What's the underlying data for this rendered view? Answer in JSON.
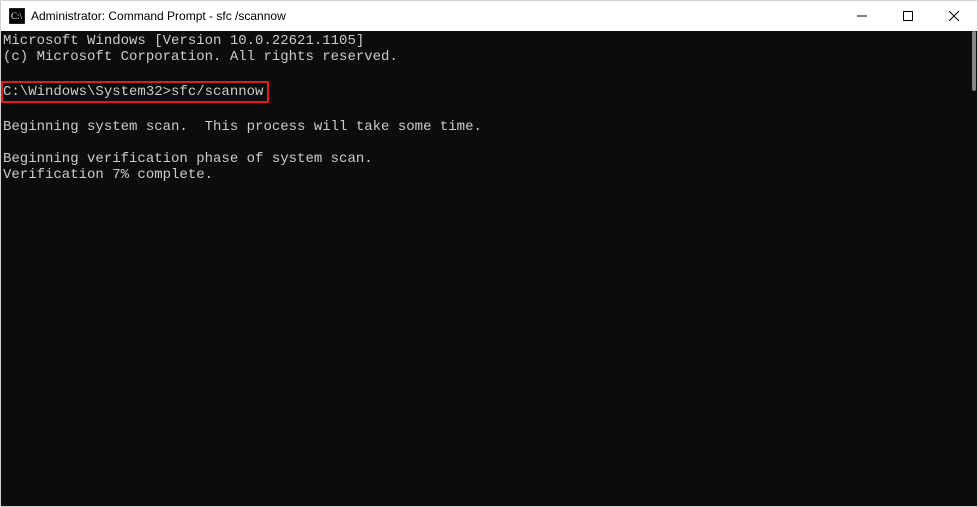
{
  "titlebar": {
    "title": "Administrator: Command Prompt - sfc /scannow"
  },
  "terminal": {
    "line1": "Microsoft Windows [Version 10.0.22621.1105]",
    "line2": "(c) Microsoft Corporation. All rights reserved.",
    "prompt_line": "C:\\Windows\\System32>sfc/scannow",
    "line4": "Beginning system scan.  This process will take some time.",
    "line5": "Beginning verification phase of system scan.",
    "line6": "Verification 7% complete."
  },
  "highlight": {
    "color": "#e11b1b"
  }
}
